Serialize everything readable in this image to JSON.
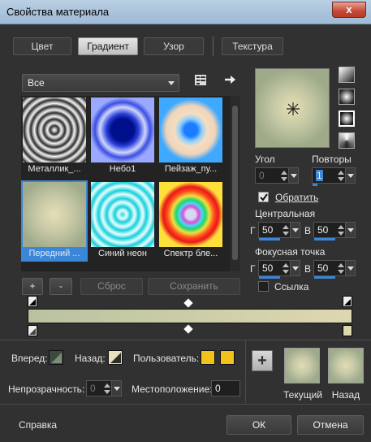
{
  "window": {
    "title": "Свойства материала",
    "close_glyph": "x"
  },
  "tabs": [
    {
      "label": "Цвет",
      "active": false
    },
    {
      "label": "Градиент",
      "active": true
    },
    {
      "label": "Узор",
      "active": false
    },
    {
      "label": "Текстура",
      "active": false
    }
  ],
  "category": {
    "value": "Все"
  },
  "presets": [
    {
      "label": "Металлик_...",
      "icon": "metallic-rings",
      "selected": false
    },
    {
      "label": "Небо1",
      "icon": "sky-radial",
      "selected": false
    },
    {
      "label": "Пейзаж_пу...",
      "icon": "landscape-radial",
      "selected": false
    },
    {
      "label": "Передний ...",
      "icon": "foreground-radial",
      "selected": true
    },
    {
      "label": "Синий неон",
      "icon": "blue-neon-radial",
      "selected": false
    },
    {
      "label": "Спектр бле...",
      "icon": "spectrum-radial",
      "selected": false
    }
  ],
  "preset_buttons": {
    "add": "+",
    "remove": "-",
    "reset": "Сброс",
    "save": "Сохранить"
  },
  "props": {
    "angle_label": "Угол",
    "angle_value": "0",
    "repeat_label": "Повторы",
    "repeat_value": "1",
    "invert_label": "Обратить",
    "invert_checked": true,
    "center_label": "Центральная",
    "center_h_axis": "Г",
    "center_h": "50",
    "center_v_axis": "В",
    "center_v": "50",
    "focal_label": "Фокусная точка",
    "focal_h_axis": "Г",
    "focal_h": "50",
    "focal_v_axis": "В",
    "focal_v": "50",
    "link_label": "Ссылка",
    "link_checked": false
  },
  "gradient_bar": {
    "start_color": "#b9c2a0",
    "end_color": "#ded8b0"
  },
  "bottom": {
    "forward_label": "Вперед:",
    "back_label": "Назад:",
    "user_label": "Пользователь:",
    "user_color": "#f2c21c",
    "opacity_label": "Непрозрачность:",
    "opacity_value": "0",
    "location_label": "Местоположение:",
    "location_value": "0",
    "current_label": "Текущий",
    "back_preview_label": "Назад",
    "add_glyph": "+"
  },
  "footer": {
    "help": "Справка",
    "ok": "ОК",
    "cancel": "Отмена"
  }
}
